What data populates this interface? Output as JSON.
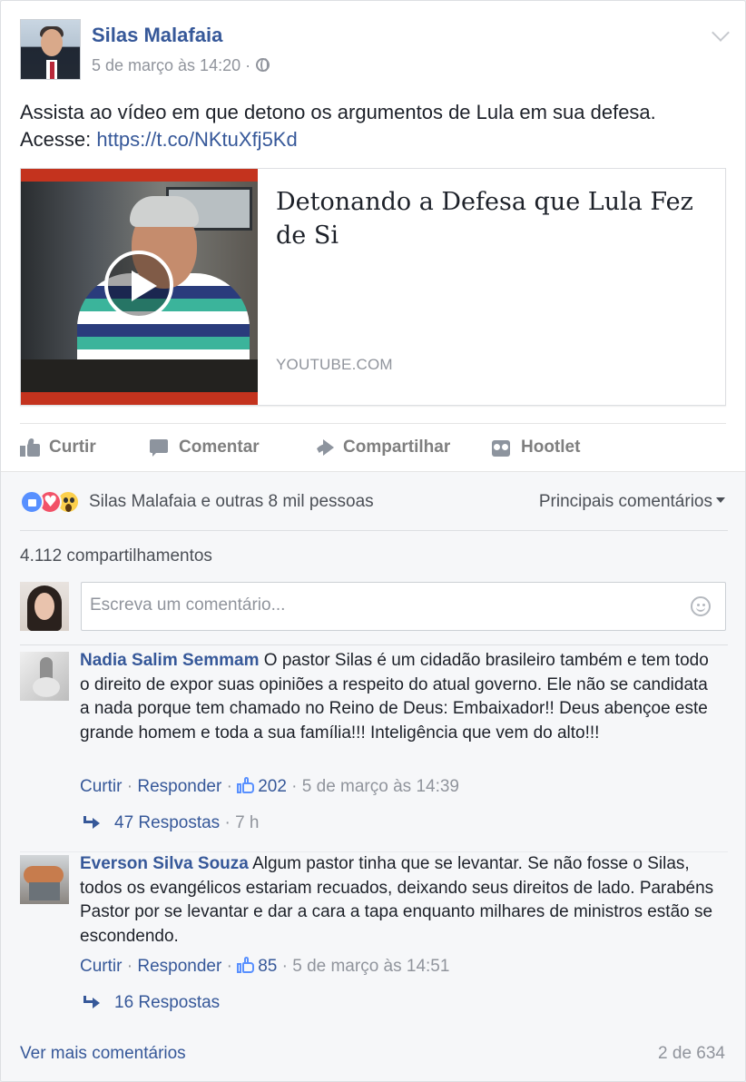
{
  "post": {
    "author": "Silas Malafaia",
    "timestamp": "5 de março às 14:20 ·",
    "text_line1": "Assista ao vídeo em que detono os argumentos de Lula em sua defesa.",
    "text_prefix": "Acesse: ",
    "link": "https://t.co/NKtuXfj5Kd"
  },
  "preview": {
    "title": "Detonando a Defesa que Lula Fez de Si",
    "source": "YOUTUBE.COM"
  },
  "actions": {
    "like": "Curtir",
    "comment": "Comentar",
    "share": "Compartilhar",
    "hootlet": "Hootlet"
  },
  "feedback": {
    "reactions_text": "Silas Malafaia e outras 8 mil pessoas",
    "top_comments": "Principais comentários",
    "shares": "4.112 compartilhamentos",
    "composer_placeholder": "Escreva um comentário..."
  },
  "comments": [
    {
      "author": "Nadia Salim Semmam",
      "text": " O pastor Silas é um cidadão brasileiro também e tem todo o direito de expor suas opiniões a respeito do atual governo. Ele não se candidata a nada porque tem chamado no Reino de Deus: Embaixador!! Deus abençoe este grande homem e toda a sua família!!! Inteligência que vem do alto!!!",
      "like": "Curtir",
      "reply": "Responder",
      "likes": "202",
      "time": "5 de março às 14:39",
      "replies": "47 Respostas",
      "replies_age": " · 7 h"
    },
    {
      "author": "Everson Silva Souza",
      "text": " Algum pastor tinha que se levantar. Se não fosse o Silas, todos os evangélicos estariam recuados, deixando seus direitos de lado. Parabéns Pastor por se levantar e dar a cara a tapa enquanto milhares de ministros estão se escondendo.",
      "like": "Curtir",
      "reply": "Responder",
      "likes": "85",
      "time": "5 de março às 14:51",
      "replies": "16 Respostas",
      "replies_age": ""
    }
  ],
  "footer": {
    "more_comments": "Ver mais comentários",
    "pager": "2 de 634"
  },
  "colors": {
    "link": "#365899",
    "muted": "#90949c",
    "like_blue": "#5890ff",
    "love_red": "#f25268",
    "wow_yellow": "#fcd04c",
    "youtube_red": "#c4331e"
  }
}
